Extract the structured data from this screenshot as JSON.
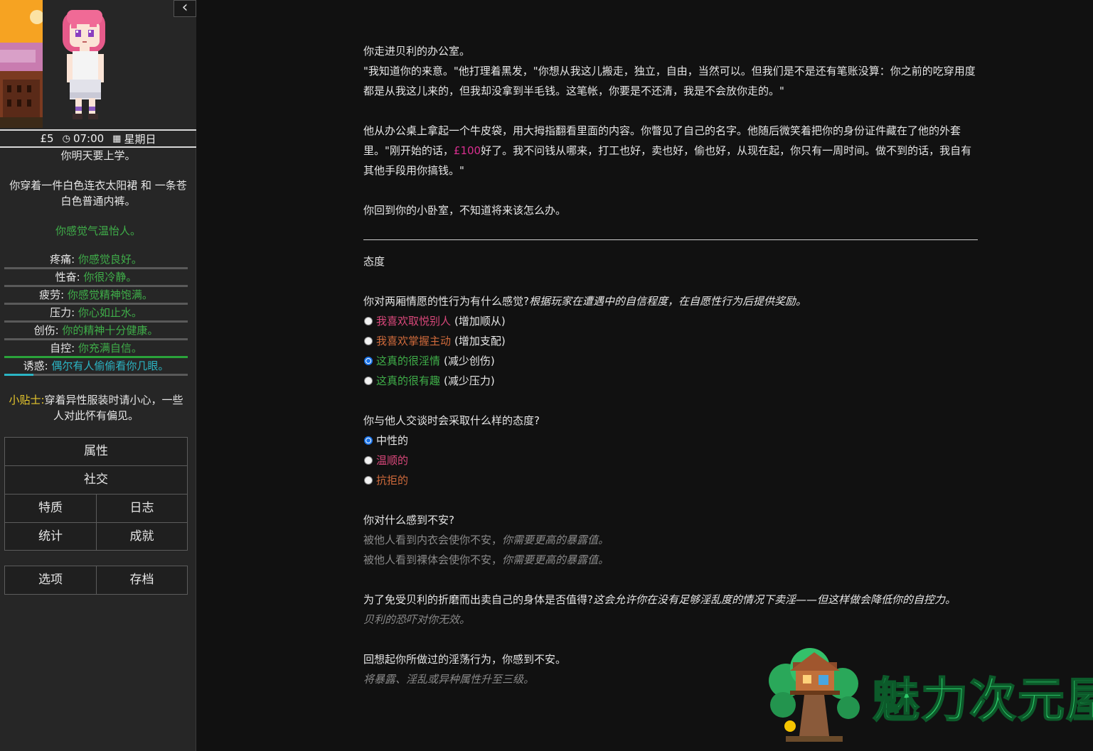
{
  "sidebar": {
    "collapse_icon": "chevron-left-icon",
    "status": {
      "money": "£5",
      "time": "07:00",
      "day": "星期日",
      "clock_icon": "clock-icon",
      "calendar_icon": "calendar-icon"
    },
    "tomorrow": "你明天要上学。",
    "clothing": "你穿着一件白色连衣太阳裙 和 一条苍白色普通内裤。",
    "temperature": "你感觉气温怡人。",
    "needs": [
      {
        "label": "疼痛:",
        "value": "你感觉良好。",
        "color": "#3fae49",
        "bar_color": "#3fae49",
        "level": 0.0
      },
      {
        "label": "性奋:",
        "value": "你很冷静。",
        "color": "#3fae49",
        "bar_color": "#3fae49",
        "level": 0.0
      },
      {
        "label": "疲劳:",
        "value": "你感觉精神饱满。",
        "color": "#3fae49",
        "bar_color": "#3fae49",
        "level": 0.0
      },
      {
        "label": "压力:",
        "value": "你心如止水。",
        "color": "#3fae49",
        "bar_color": "#3fae49",
        "level": 0.0
      },
      {
        "label": "创伤:",
        "value": "你的精神十分健康。",
        "color": "#3fae49",
        "bar_color": "#3fae49",
        "level": 0.0
      },
      {
        "label": "自控:",
        "value": "你充满自信。",
        "color": "#3fae49",
        "bar_color": "#2aa33a",
        "level": 1.0
      },
      {
        "label": "诱惑:",
        "value": "偶尔有人偷偷看你几眼。",
        "color": "#2bb5c4",
        "bar_color": "#2bb5c4",
        "level": 0.16
      }
    ],
    "tip": {
      "label": "小贴士:",
      "text": "穿着异性服装时请小心，一些人对此怀有偏见。"
    },
    "menu": {
      "attributes": "属性",
      "social": "社交",
      "traits": "特质",
      "journal": "日志",
      "statistics": "统计",
      "achievements": "成就",
      "options": "选项",
      "saves": "存档"
    }
  },
  "story": {
    "p1": "你走进贝利的办公室。",
    "p2": "\"我知道你的来意。\"他打理着黑发，\"你想从我这儿搬走，独立，自由，当然可以。但我们是不是还有笔账没算：你之前的吃穿用度都是从我这儿来的，但我却没拿到半毛钱。这笔帐，你要是不还清，我是不会放你走的。\"",
    "p3_a": "他从办公桌上拿起一个牛皮袋，用大拇指翻看里面的内容。你瞥见了自己的名字。他随后微笑着把你的身份证件藏在了他的外套里。\"刚开始的话，",
    "p3_money": "£100",
    "p3_b": "好了。我不问钱从哪来，打工也好，卖也好，偷也好，从现在起，你只有一周时间。做不到的话，我自有其他手段用你搞钱。\"",
    "p4": "你回到你的小卧室，不知道将来该怎么办。"
  },
  "attitude": {
    "heading": "态度",
    "q1": {
      "question": "你对两厢情愿的性行为有什么感觉?",
      "hint": "根据玩家在遭遇中的自信程度，在自愿性行为后提供奖励。",
      "options": [
        {
          "label": "我喜欢取悦别人",
          "effect": "(增加顺从)",
          "selected": false
        },
        {
          "label": "我喜欢掌握主动",
          "effect": "(增加支配)",
          "selected": false
        },
        {
          "label": "这真的很淫情",
          "effect": "(减少创伤)",
          "selected": true
        },
        {
          "label": "这真的很有趣",
          "effect": "(减少压力)",
          "selected": false
        }
      ]
    },
    "q2": {
      "question": "你与他人交谈时会采取什么样的态度?",
      "options": [
        {
          "label": "中性的",
          "selected": true
        },
        {
          "label": "温顺的",
          "selected": false
        },
        {
          "label": "抗拒的",
          "selected": false
        }
      ]
    },
    "q3": {
      "question": "你对什么感到不安?",
      "lines": [
        {
          "a": "被他人看到内衣会使你不安，",
          "b": "你需要更高的暴露值。"
        },
        {
          "a": "被他人看到裸体会使你不安，",
          "b": "你需要更高的暴露值。"
        }
      ]
    },
    "q4": {
      "question": "为了免受贝利的折磨而出卖自己的身体是否值得?",
      "hint": "这会允许你在没有足够淫乱度的情况下卖淫——但这样做会降低你的自控力。",
      "note": "贝利的恐吓对你无效。"
    },
    "q5": {
      "question": "回想起你所做过的淫荡行为，你感到不安。",
      "note": "将暴露、淫乱或异种属性升至三级。"
    }
  },
  "watermark": {
    "text": "魅力次元屋",
    "logo_icon": "treehouse-logo-icon"
  }
}
